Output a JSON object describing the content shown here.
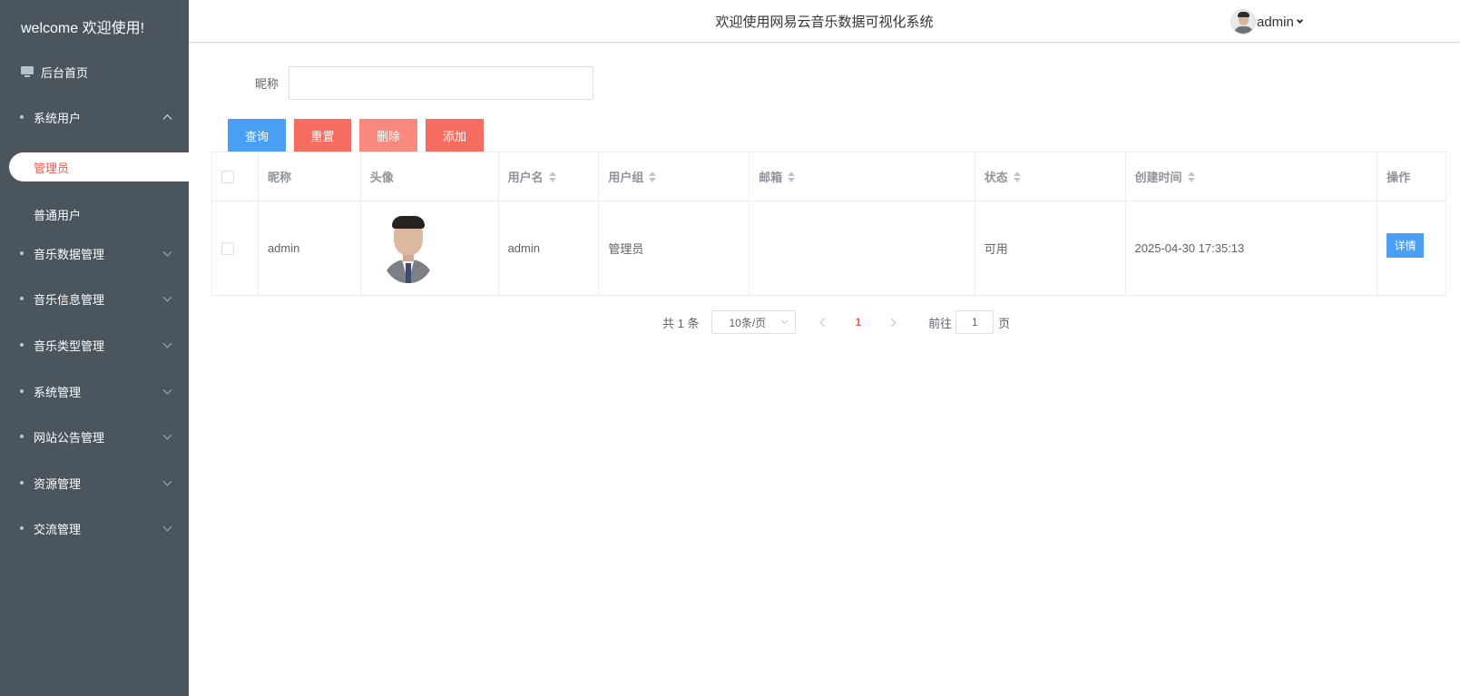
{
  "sidebar": {
    "title": "welcome 欢迎使用!",
    "home": "后台首页",
    "groups": [
      {
        "label": "系统用户",
        "expanded": true
      },
      {
        "label": "音乐数据管理"
      },
      {
        "label": "音乐信息管理"
      },
      {
        "label": "音乐类型管理"
      },
      {
        "label": "系统管理"
      },
      {
        "label": "网站公告管理"
      },
      {
        "label": "资源管理"
      },
      {
        "label": "交流管理"
      }
    ],
    "submenu": {
      "active": "管理员",
      "other": "普通用户"
    }
  },
  "header": {
    "title": "欢迎使用网易云音乐数据可视化系统",
    "user": "admin"
  },
  "search": {
    "label": "昵称",
    "value": "",
    "placeholder": ""
  },
  "toolbar": {
    "query": "查询",
    "reset": "重置",
    "delete": "删除",
    "add": "添加"
  },
  "table": {
    "headers": {
      "nickname": "昵称",
      "avatar": "头像",
      "username": "用户名",
      "group": "用户组",
      "email": "邮箱",
      "status": "状态",
      "created": "创建时间",
      "action": "操作"
    },
    "rows": [
      {
        "nickname": "admin",
        "username": "admin",
        "group": "管理员",
        "email": "",
        "status": "可用",
        "created": "2025-04-30 17:35:13",
        "action": "详情"
      }
    ]
  },
  "pagination": {
    "total": "共 1 条",
    "page_size": "10条/页",
    "current": "1",
    "goto_label": "前往",
    "goto_value": "1",
    "unit": "页"
  },
  "colors": {
    "sidebar_bg": "#4a555e",
    "primary": "#4a9ff5",
    "danger": "#f56c61",
    "active_text": "#e8625a"
  }
}
